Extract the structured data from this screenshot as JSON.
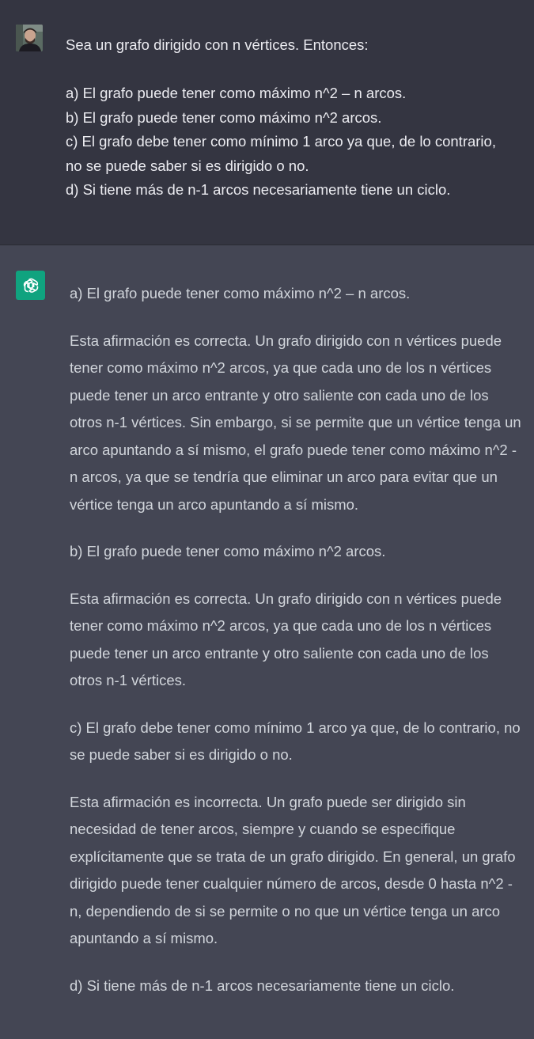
{
  "user_message": {
    "intro": "Sea un grafo dirigido con n vértices. Entonces:",
    "options": [
      "a) El grafo puede tener como máximo n^2 – n arcos.",
      "b) El grafo puede tener como máximo n^2 arcos.",
      "c) El grafo debe tener como mínimo 1 arco ya que, de lo contrario, no se puede saber si es dirigido o no.",
      "d) Si tiene más de n-1 arcos necesariamente tiene un ciclo."
    ]
  },
  "assistant_message": {
    "paragraphs": [
      "a) El grafo puede tener como máximo n^2 – n arcos.",
      "Esta afirmación es correcta. Un grafo dirigido con n vértices puede tener como máximo n^2 arcos, ya que cada uno de los n vértices puede tener un arco entrante y otro saliente con cada uno de los otros n-1 vértices. Sin embargo, si se permite que un vértice tenga un arco apuntando a sí mismo, el grafo puede tener como máximo n^2 - n arcos, ya que se tendría que eliminar un arco para evitar que un vértice tenga un arco apuntando a sí mismo.",
      "b) El grafo puede tener como máximo n^2 arcos.",
      "Esta afirmación es correcta. Un grafo dirigido con n vértices puede tener como máximo n^2 arcos, ya que cada uno de los n vértices puede tener un arco entrante y otro saliente con cada uno de los otros n-1 vértices.",
      "c) El grafo debe tener como mínimo 1 arco ya que, de lo contrario, no se puede saber si es dirigido o no.",
      "Esta afirmación es incorrecta. Un grafo puede ser dirigido sin necesidad de tener arcos, siempre y cuando se especifique explícitamente que se trata de un grafo dirigido. En general, un grafo dirigido puede tener cualquier número de arcos, desde 0 hasta n^2 - n, dependiendo de si se permite o no que un vértice tenga un arco apuntando a sí mismo.",
      "d) Si tiene más de n-1 arcos necesariamente tiene un ciclo."
    ]
  },
  "icons": {
    "user_avatar": "user-avatar-photo",
    "assistant_avatar": "openai-logo-icon"
  },
  "colors": {
    "user_bg": "#343541",
    "assistant_bg": "#444654",
    "accent": "#10a37f"
  }
}
